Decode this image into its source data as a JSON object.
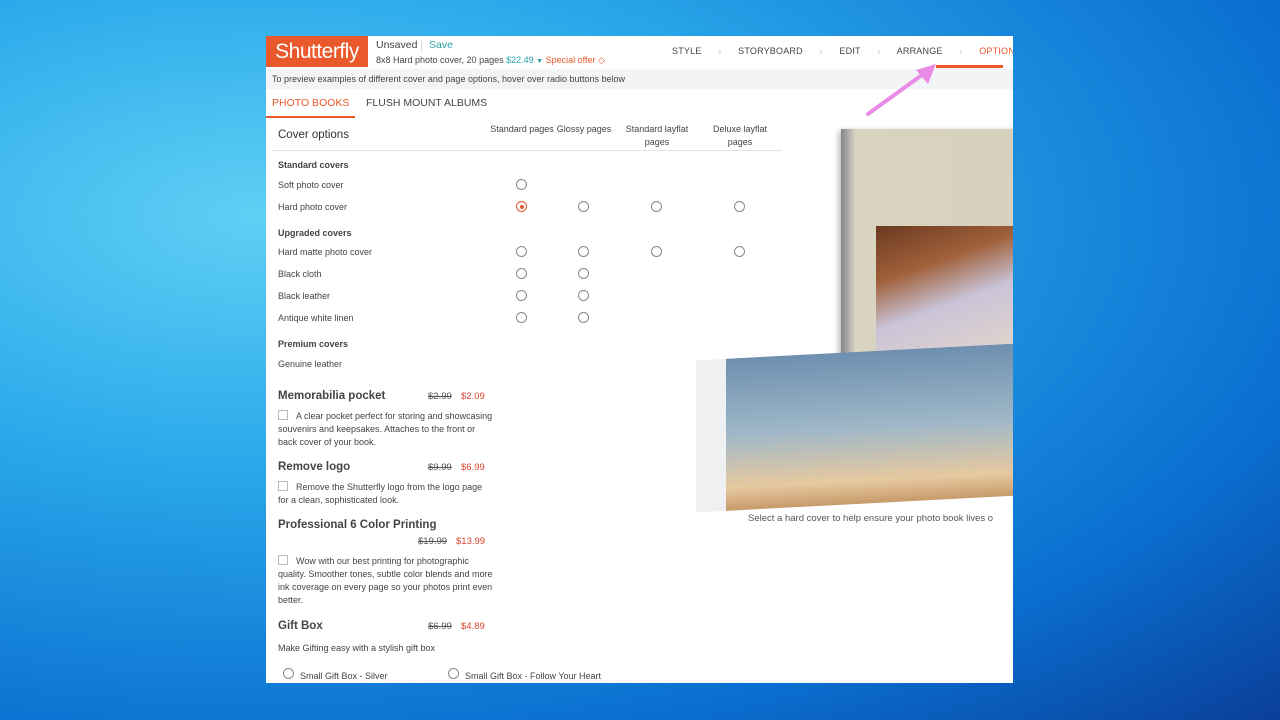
{
  "header": {
    "logo": "Shutterfly",
    "status": "Unsaved",
    "save": "Save",
    "product": "8x8 Hard photo cover, 20 pages",
    "price": "$22.49",
    "special_offer": "Special offer",
    "steps": [
      {
        "label": "STYLE"
      },
      {
        "label": "STORYBOARD"
      },
      {
        "label": "EDIT"
      },
      {
        "label": "ARRANGE"
      },
      {
        "label": "OPTIONS",
        "active": true
      }
    ]
  },
  "hint": "To preview examples of different cover and page options, hover over radio buttons below",
  "tabs": [
    {
      "label": "PHOTO BOOKS",
      "active": true
    },
    {
      "label": "FLUSH MOUNT ALBUMS"
    }
  ],
  "cover_options": {
    "title": "Cover options",
    "columns": [
      "Standard pages",
      "Glossy pages",
      "Standard layflat pages",
      "Deluxe layflat pages"
    ],
    "groups": [
      {
        "label": "Standard covers",
        "rows": [
          {
            "label": "Soft photo cover",
            "avail": [
              1,
              0,
              0,
              0
            ]
          },
          {
            "label": "Hard photo cover",
            "avail": [
              1,
              1,
              1,
              1
            ],
            "selected": 0
          }
        ]
      },
      {
        "label": "Upgraded covers",
        "rows": [
          {
            "label": "Hard matte photo cover",
            "avail": [
              1,
              1,
              1,
              1
            ]
          },
          {
            "label": "Black cloth",
            "avail": [
              1,
              1,
              0,
              0
            ]
          },
          {
            "label": "Black leather",
            "avail": [
              1,
              1,
              0,
              0
            ]
          },
          {
            "label": "Antique white linen",
            "avail": [
              1,
              1,
              0,
              0
            ]
          }
        ]
      },
      {
        "label": "Premium covers",
        "rows": [
          {
            "label": "Genuine leather",
            "avail": [
              0,
              0,
              0,
              1
            ]
          }
        ]
      }
    ]
  },
  "addons": [
    {
      "title": "Memorabilia pocket",
      "old": "$2.99",
      "new": "$2.09",
      "desc": "A clear pocket perfect for storing and showcasing souvenirs and keepsakes. Attaches to the front or back cover of your book."
    },
    {
      "title": "Remove logo",
      "old": "$9.99",
      "new": "$6.99",
      "desc": "Remove the Shutterfly logo from the logo page for a clean, sophisticated look."
    },
    {
      "title": "Professional 6 Color Printing",
      "old": "$19.99",
      "new": "$13.99",
      "desc": "Wow with our best printing for photographic quality. Smoother tones, subtle color blends and more ink coverage on every page so your photos print even better."
    }
  ],
  "gift_box": {
    "title": "Gift Box",
    "old": "$6.99",
    "new": "$4.89",
    "desc": "Make Gifting easy with a stylish gift box",
    "options": [
      "Small Gift Box - Silver",
      "Small Gift Box - Follow Your Heart"
    ]
  },
  "preview_caption": "Select a hard cover to help ensure your photo book lives o",
  "colors": {
    "brand": "#e9592b",
    "price_link": "#2ba3a8",
    "sale": "#d9432f",
    "annotation_arrow": "#e98ae6"
  }
}
